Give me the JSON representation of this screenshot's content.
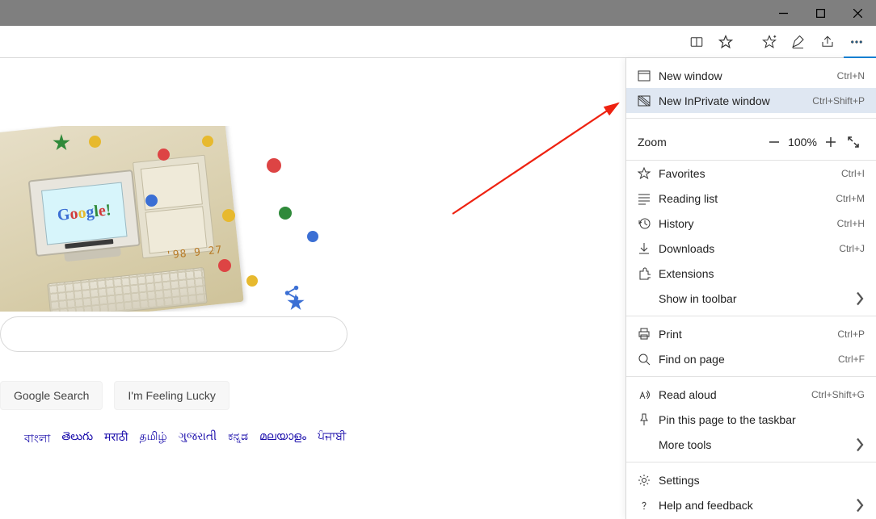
{
  "toolbar": {
    "icons": {
      "reading": "reading-view-icon",
      "star": "favorite-star-icon",
      "add_fav": "add-favorites-icon",
      "notes": "web-notes-icon",
      "share": "share-icon",
      "more": "more-icon"
    }
  },
  "google": {
    "logo_text": "Google!",
    "doodle_date": "'98 9 27",
    "search_button": "Google Search",
    "lucky_button": "I'm Feeling Lucky",
    "languages": [
      "বাংলা",
      "తెలుగు",
      "मराठी",
      "தமிழ்",
      "ગુજરાતી",
      "ಕನ್ನಡ",
      "മലയാളം",
      "ਪੰਜਾਬੀ"
    ]
  },
  "menu": {
    "new_window": {
      "label": "New window",
      "shortcut": "Ctrl+N"
    },
    "new_inprivate": {
      "label": "New InPrivate window",
      "shortcut": "Ctrl+Shift+P"
    },
    "zoom_label": "Zoom",
    "zoom_value": "100%",
    "favorites": {
      "label": "Favorites",
      "shortcut": "Ctrl+I"
    },
    "reading_list": {
      "label": "Reading list",
      "shortcut": "Ctrl+M"
    },
    "history": {
      "label": "History",
      "shortcut": "Ctrl+H"
    },
    "downloads": {
      "label": "Downloads",
      "shortcut": "Ctrl+J"
    },
    "extensions": {
      "label": "Extensions"
    },
    "show_toolbar": {
      "label": "Show in toolbar"
    },
    "print": {
      "label": "Print",
      "shortcut": "Ctrl+P"
    },
    "find": {
      "label": "Find on page",
      "shortcut": "Ctrl+F"
    },
    "read_aloud": {
      "label": "Read aloud",
      "shortcut": "Ctrl+Shift+G"
    },
    "pin": {
      "label": "Pin this page to the taskbar"
    },
    "more_tools": {
      "label": "More tools"
    },
    "settings": {
      "label": "Settings"
    },
    "help": {
      "label": "Help and feedback"
    }
  }
}
